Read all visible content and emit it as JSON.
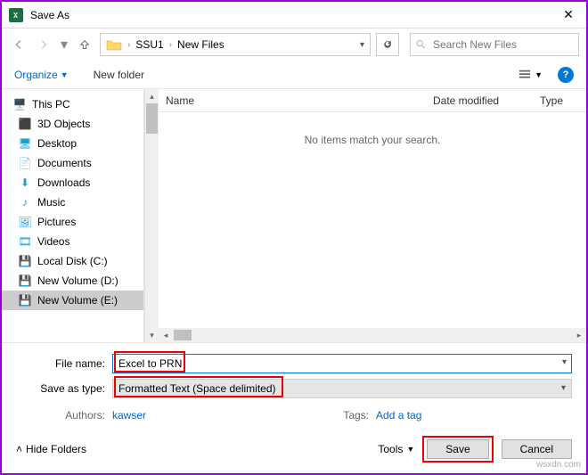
{
  "title": "Save As",
  "breadcrumb": {
    "item1": "SSU1",
    "item2": "New Files",
    "dd": "▾"
  },
  "search": {
    "placeholder": "Search New Files"
  },
  "toolbar": {
    "organize": "Organize",
    "newfolder": "New folder"
  },
  "columns": {
    "name": "Name",
    "date": "Date modified",
    "type": "Type"
  },
  "empty_msg": "No items match your search.",
  "tree": {
    "thispc": "This PC",
    "items": [
      "3D Objects",
      "Desktop",
      "Documents",
      "Downloads",
      "Music",
      "Pictures",
      "Videos",
      "Local Disk (C:)",
      "New Volume (D:)",
      "New Volume (E:)"
    ]
  },
  "form": {
    "fname_label": "File name:",
    "fname_value": "Excel to PRN",
    "type_label": "Save as type:",
    "type_value": "Formatted Text (Space delimited)",
    "authors_label": "Authors:",
    "authors_value": "kawser",
    "tags_label": "Tags:",
    "tags_value": "Add a tag"
  },
  "actions": {
    "hide": "Hide Folders",
    "tools": "Tools",
    "save": "Save",
    "cancel": "Cancel"
  },
  "watermark": "wsxdn.com"
}
